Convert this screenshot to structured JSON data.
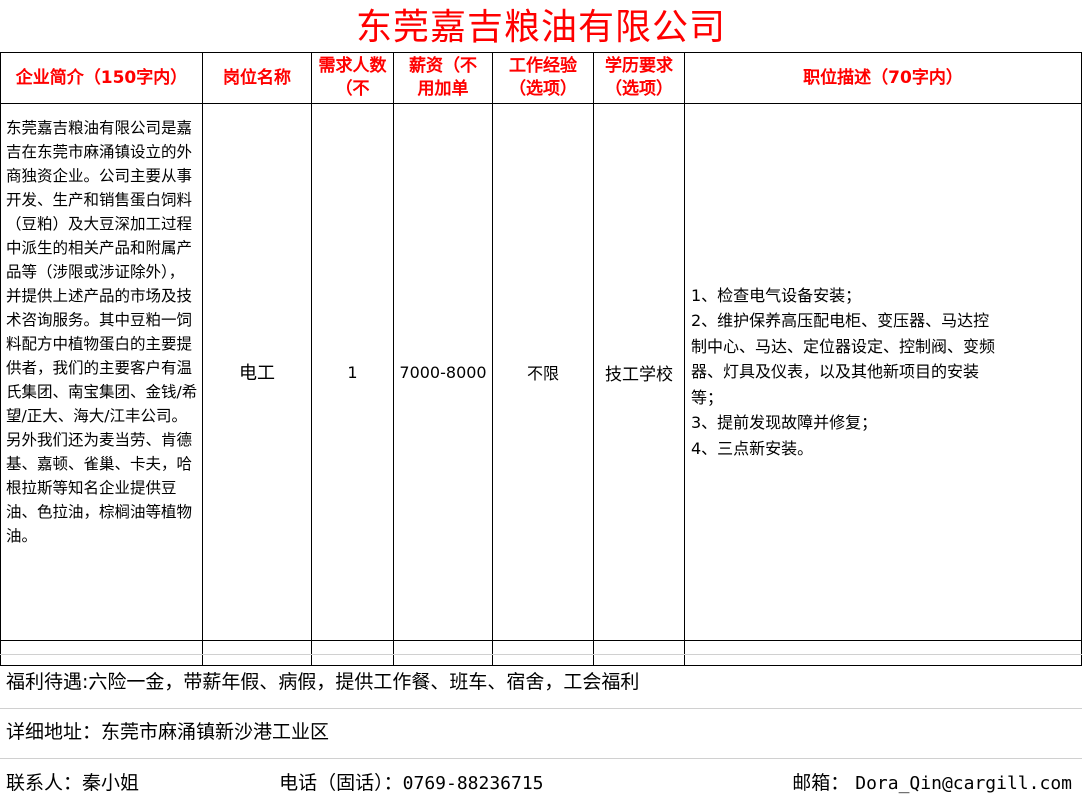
{
  "title": "东莞嘉吉粮油有限公司",
  "colors": {
    "title": "#ff0000",
    "header": "#ff0000",
    "border": "#000000"
  },
  "headers": [
    "企业简介（150字内）",
    "岗位名称",
    "需求人数（不",
    "薪资（不用加单",
    "工作经验（选项）",
    "学历要求（选项）",
    "职位描述（70字内）"
  ],
  "row": {
    "intro": "东莞嘉吉粮油有限公司是嘉吉在东莞市麻涌镇设立的外商独资企业。公司主要从事开发、生产和销售蛋白饲料（豆粕）及大豆深加工过程中派生的相关产品和附属产品等（涉限或涉证除外），并提供上述产品的市场及技术咨询服务。其中豆粕一饲料配方中植物蛋白的主要提供者，我们的主要客户有温氏集团、南宝集团、金钱/希望/正大、海大/江丰公司。另外我们还为麦当劳、肯德基、嘉顿、雀巢、卡夫，哈根拉斯等知名企业提供豆油、色拉油，棕榈油等植物油。",
    "position": "电工",
    "headcount": "1",
    "salary": "7000-8000",
    "experience": "不限",
    "education": "技工学校",
    "description": [
      "1、检查电气设备安装；",
      "2、维护保养高压配电柜、变压器、马达控",
      "制中心、马达、定位器设定、控制阀、变频",
      "器、灯具及仪表，以及其他新项目的安装",
      "等；",
      "3、提前发现故障并修复；",
      "4、三点新安装。"
    ]
  },
  "footer": {
    "benefits": "福利待遇:六险一金，带薪年假、病假，提供工作餐、班车、宿舍，工会福利",
    "address": "详细地址：东莞市麻涌镇新沙港工业区",
    "contact_label": "联系人：",
    "contact_name": "秦小姐",
    "phone_label": "电话（固话）：",
    "phone": "0769-88236715",
    "email_label": "邮箱：",
    "email": "Dora_Qin@cargill.com"
  }
}
